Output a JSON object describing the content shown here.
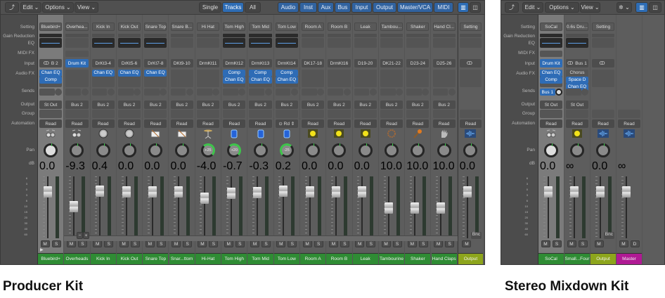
{
  "colors": {
    "name_green": "#2f8c34",
    "output_olive": "#8da51c",
    "master_magenta": "#b01a94",
    "accent_blue": "#2e6cb6"
  },
  "row_labels": {
    "setting": "Setting",
    "gain": "Gain Reduction",
    "eq": "EQ",
    "midi": "MIDI FX",
    "input": "Input",
    "fx": "Audio FX",
    "sends": "Sends",
    "output": "Output",
    "group": "Group",
    "automation": "Automation",
    "pan": "Pan",
    "db": "dB"
  },
  "fader_scale": [
    "6",
    "3",
    "0",
    "3",
    "6",
    "10",
    "15",
    "20",
    "30",
    "40",
    "60"
  ],
  "left": {
    "caption": "Producer Kit",
    "toolbar": {
      "back": "⤴",
      "edit": "Edit ⌄",
      "options": "Options ⌄",
      "view": "View ⌄",
      "single": "Single",
      "tracks": "Tracks",
      "all": "All",
      "filters": [
        "Audio",
        "Inst",
        "Aux",
        "Bus",
        "Input",
        "Output",
        "Master/VCA",
        "MIDI"
      ]
    },
    "minus": "−",
    "plus": "+",
    "channels": [
      {
        "name": "Bluebird+",
        "setting": "Bluebird+",
        "gr": true,
        "eq": true,
        "midi": false,
        "input": "B 2",
        "link": true,
        "fx": [
          "Chan EQ",
          "Comp"
        ],
        "output": "St Out",
        "auto": "Read",
        "icon": "drumkit",
        "pan": "",
        "pan_val": 0,
        "db": "0.0",
        "fader": 0,
        "color": "green",
        "sel": true
      },
      {
        "name": "Overheads",
        "setting": "Overhea...",
        "gr": false,
        "eq": false,
        "midi": true,
        "input": "Drum Kit",
        "input_blue": true,
        "fx": [],
        "output": "Bus 2",
        "auto": "Read",
        "icon": "drumkit",
        "pan": "",
        "pan_val": 0,
        "db": "-9.3",
        "fader": -9.3,
        "color": "green"
      },
      {
        "name": "Kick In",
        "setting": "Kick In",
        "gr": false,
        "eq": true,
        "input": "DrKt3-4",
        "fx": [
          "Chan EQ"
        ],
        "output": "Bus 2",
        "auto": "Read",
        "icon": "kick",
        "pan": "",
        "pan_val": 0,
        "db": "0.4",
        "fader": 0.4,
        "color": "green"
      },
      {
        "name": "Kick Out",
        "setting": "Kick Out",
        "gr": false,
        "eq": true,
        "input": "DrKt5-6",
        "fx": [
          "Chan EQ"
        ],
        "output": "Bus 2",
        "auto": "Read",
        "icon": "kick",
        "pan": "",
        "pan_val": 0,
        "db": "0.0",
        "fader": 0,
        "color": "green"
      },
      {
        "name": "Snare Top",
        "setting": "Snare Top",
        "gr": false,
        "eq": true,
        "input": "DrKt7-8",
        "fx": [
          "Chan EQ"
        ],
        "output": "Bus 2",
        "auto": "Read",
        "icon": "snare",
        "pan": "",
        "pan_val": 0,
        "db": "0.0",
        "fader": 0,
        "color": "green"
      },
      {
        "name": "Snar...ttom",
        "setting": "Snare B...",
        "gr": false,
        "eq": false,
        "input": "DKt9-10",
        "fx": [],
        "output": "Bus 2",
        "auto": "Read",
        "icon": "snare",
        "pan": "",
        "pan_val": 0,
        "db": "0.0",
        "fader": 0,
        "color": "green"
      },
      {
        "name": "Hi-Hat",
        "setting": "Hi Hat",
        "gr": false,
        "eq": false,
        "input": "DrmKt11",
        "fx": [],
        "output": "Bus 2",
        "auto": "Read",
        "icon": "hihat",
        "pan": "+25",
        "pan_val": 25,
        "db": "-4.0",
        "fader": -4,
        "color": "green"
      },
      {
        "name": "Tom High",
        "setting": "Tom High",
        "gr": true,
        "eq": true,
        "input": "DrmKt12",
        "fx": [
          "Comp",
          "Chan EQ"
        ],
        "output": "Bus 2",
        "auto": "Read",
        "icon": "tom",
        "pan": "+20",
        "pan_val": 20,
        "db": "-0.7",
        "fader": -0.7,
        "color": "green"
      },
      {
        "name": "Tom Mid",
        "setting": "Tom Mid",
        "gr": true,
        "eq": true,
        "input": "DrmKt13",
        "fx": [
          "Comp",
          "Chan EQ"
        ],
        "output": "Bus 2",
        "auto": "Read",
        "icon": "tom",
        "pan": "",
        "pan_val": 0,
        "db": "-0.3",
        "fader": -0.3,
        "color": "green"
      },
      {
        "name": "Tom Low",
        "setting": "Tom Low",
        "gr": true,
        "eq": true,
        "input": "DrmKt14",
        "fx": [
          "Comp",
          "Chan EQ"
        ],
        "output": "Bus 2",
        "auto": "⊙  Rd ⇕",
        "icon": "tom",
        "pan": "-25",
        "pan_val": -25,
        "db": "0.2",
        "fader": 0.2,
        "color": "green"
      },
      {
        "name": "Room A",
        "setting": "Room A",
        "gr": false,
        "eq": false,
        "input": "DK17-18",
        "fx": [],
        "output": "Bus 2",
        "auto": "Read",
        "icon": "room",
        "pan": "",
        "pan_val": 0,
        "db": "0.0",
        "fader": 0,
        "color": "green"
      },
      {
        "name": "Room B",
        "setting": "Room B",
        "gr": false,
        "eq": false,
        "input": "DrmKt16",
        "fx": [],
        "output": "Bus 2",
        "auto": "Read",
        "icon": "room",
        "pan": "",
        "pan_val": 0,
        "db": "0.0",
        "fader": 0,
        "color": "green"
      },
      {
        "name": "Leak",
        "setting": "Leak",
        "gr": false,
        "eq": false,
        "input": "D19-20",
        "fx": [],
        "output": "Bus 2",
        "auto": "Read",
        "icon": "room",
        "pan": "",
        "pan_val": 0,
        "db": "0.0",
        "fader": 0,
        "color": "green"
      },
      {
        "name": "Tambourine",
        "setting": "Tambou...",
        "gr": false,
        "eq": false,
        "input": "DK21-22",
        "fx": [],
        "output": "Bus 2",
        "auto": "Read",
        "icon": "tambourine",
        "pan": "",
        "pan_val": 0,
        "db": "10.0",
        "fader": -10,
        "color": "green"
      },
      {
        "name": "Shaker",
        "setting": "Shaker",
        "gr": false,
        "eq": false,
        "input": "D23-24",
        "fx": [],
        "output": "Bus 2",
        "auto": "Read",
        "icon": "shaker",
        "pan": "",
        "pan_val": 0,
        "db": "10.0",
        "fader": -10,
        "color": "green"
      },
      {
        "name": "Hand Claps",
        "setting": "Hand Cl...",
        "gr": false,
        "eq": false,
        "input": "D25-26",
        "fx": [],
        "output": "Bus 2",
        "auto": "Read",
        "icon": "hand",
        "pan": "",
        "pan_val": 0,
        "db": "10.0",
        "fader": -10,
        "color": "green"
      },
      {
        "name": "Output",
        "setting": "Setting",
        "gr": false,
        "eq": false,
        "input": "",
        "link": true,
        "fx": [],
        "nosend": true,
        "output": null,
        "auto": "Read",
        "icon": "wave",
        "pan": "",
        "pan_val": 0,
        "db": "0.0",
        "fader": 0,
        "color": "olive",
        "bnc": "Bnc",
        "mute_only": true,
        "divider": true
      }
    ]
  },
  "right": {
    "caption": "Stereo Mixdown Kit",
    "toolbar": {
      "back": "⤴",
      "edit": "Edit ⌄",
      "options": "Options ⌄",
      "view": "View ⌄",
      "gear": "✲ ⌄"
    },
    "channels": [
      {
        "name": "SoCal",
        "setting": "SoCal",
        "gr": true,
        "eq": true,
        "midi": true,
        "input": "Drum Kit",
        "input_blue": true,
        "fx": [
          "Chan EQ",
          "Comp"
        ],
        "send": "Bus 1",
        "sendon": true,
        "output": "St Out",
        "auto": "Read",
        "icon": "drumkit",
        "pan": "",
        "pan_val": 0,
        "db": "0.0",
        "fader": 0,
        "color": "green",
        "sel": true
      },
      {
        "name": "Small...Four",
        "setting": "0.6s Dru...",
        "gr": false,
        "eq": true,
        "input": "Bus 1",
        "link": true,
        "fx": [
          "Chorus",
          "Space D",
          "Chan EQ"
        ],
        "fx_plain_first": true,
        "output": "St Out",
        "auto": "Read",
        "icon": "room",
        "pan": "",
        "pan_val": 0,
        "db": "∞",
        "fader": 0,
        "color": "green"
      },
      {
        "name": "Output",
        "setting": "Setting",
        "gr": false,
        "eq": false,
        "input": "",
        "link": true,
        "fx": [],
        "nosend": true,
        "output": null,
        "auto": "Read",
        "icon": "wave",
        "pan": "",
        "pan_val": 0,
        "db": "0.0",
        "fader": 0,
        "color": "olive",
        "bnc": "Bnc",
        "mute_only": true
      },
      {
        "name": "Master",
        "setting": null,
        "nogr": true,
        "eq": false,
        "noeq": true,
        "input": null,
        "fx": null,
        "nosend": true,
        "output": null,
        "auto": "Read",
        "icon": "wave",
        "nopan": true,
        "db": "∞",
        "dbwide": true,
        "fader": 0,
        "color": "magenta",
        "md": true
      }
    ]
  },
  "buttons": {
    "mute": "M",
    "solo": "S",
    "dim": "D"
  }
}
